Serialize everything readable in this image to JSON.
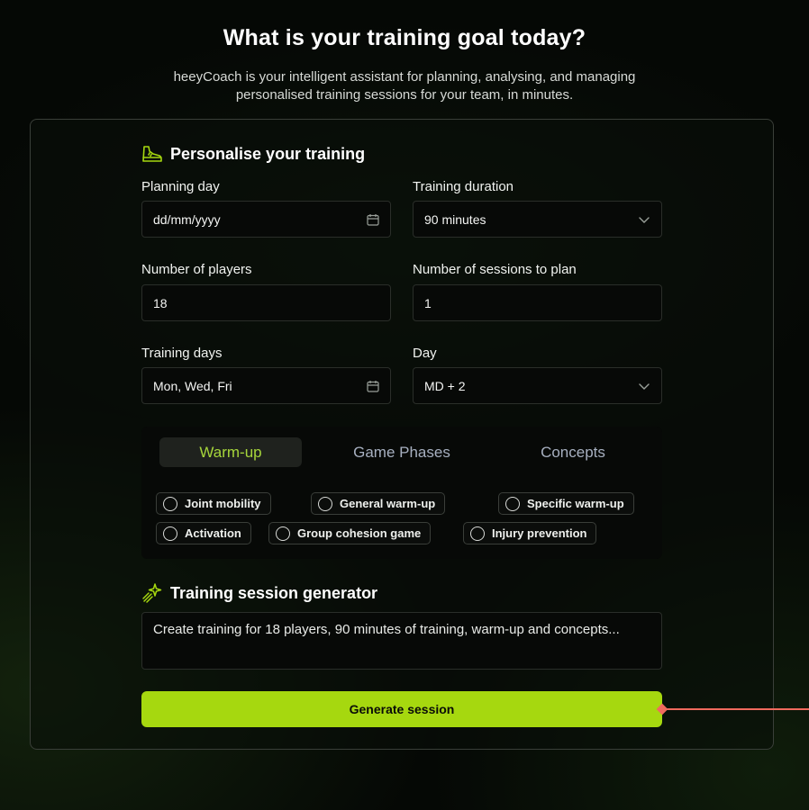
{
  "header": {
    "title": "What is your training goal today?",
    "subtitle": "heeyCoach is your intelligent assistant for planning, analysing, and managing personalised training sessions for your team, in minutes."
  },
  "personalise": {
    "heading": "Personalise your training",
    "icon": "sneaker-icon",
    "planning_day": {
      "label": "Planning day",
      "placeholder": "dd/mm/yyyy"
    },
    "training_duration": {
      "label": "Training duration",
      "value": "90 minutes"
    },
    "number_of_players": {
      "label": "Number of players",
      "value": "18"
    },
    "sessions_to_plan": {
      "label": "Number of sessions to plan",
      "value": "1"
    },
    "training_days": {
      "label": "Training days",
      "value": "Mon, Wed, Fri"
    },
    "day": {
      "label": "Day",
      "value": "MD + 2"
    }
  },
  "tabs": {
    "items": [
      "Warm-up",
      "Game Phases",
      "Concepts"
    ],
    "active": "Warm-up"
  },
  "options": [
    "Joint mobility",
    "General warm-up",
    "Specific warm-up",
    "Activation",
    "Group cohesion game",
    "Injury prevention"
  ],
  "generator": {
    "heading": "Training session generator",
    "icon": "sparkle-icon",
    "prompt_text": "Create training for 18 players, 90 minutes of training, warm-up and concepts...",
    "button_label": "Generate session"
  },
  "colors": {
    "accent": "#a6d80f",
    "tab_active_text": "#a6d53b",
    "connector": "#f06a5e"
  }
}
